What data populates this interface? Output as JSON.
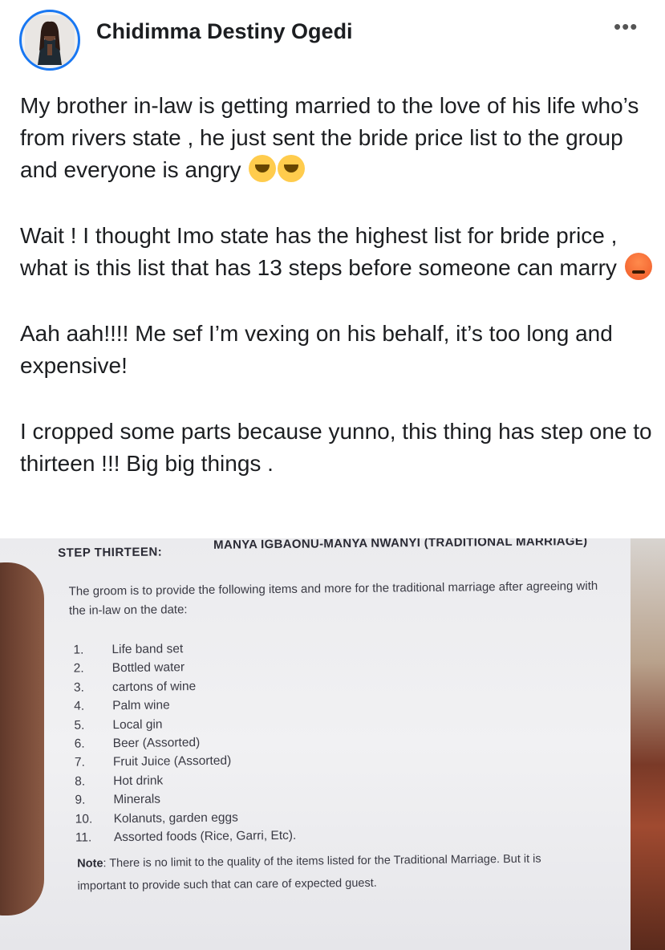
{
  "header": {
    "author": "Chidimma Destiny Ogedi",
    "more_icon": "•••"
  },
  "post": {
    "p1": "My brother in-law is getting married to the love of his life who’s from rivers state , he just sent the bride price list to the group and everyone is angry",
    "p2": "Wait ! I thought Imo state has the highest list for bride price , what is this list that has 13 steps before someone can marry",
    "p3": "Aah aah!!!! Me sef I’m vexing on his behalf, it’s too long and expensive!",
    "p4": "I cropped some parts because yunno, this thing has step one to thirteen !!! Big big things ."
  },
  "emojis": {
    "p1": [
      "face-with-tears-of-joy-icon",
      "face-with-tears-of-joy-icon"
    ],
    "p2": [
      "angry-face-icon"
    ]
  },
  "document": {
    "step_label": "STEP THIRTEEN:",
    "step_title": "MANYA IGBAONU-MANYA NWANYI (TRADITIONAL MARRIAGE)",
    "intro": "The groom is to provide the following items and more for the traditional marriage after agreeing with the in-law on the date:",
    "items": [
      {
        "num": "1.",
        "text": "Life band set"
      },
      {
        "num": "2.",
        "text": "Bottled water"
      },
      {
        "num": "3.",
        "text": "cartons of wine"
      },
      {
        "num": "4.",
        "text": "Palm wine"
      },
      {
        "num": "5.",
        "text": "Local gin"
      },
      {
        "num": "6.",
        "text": "Beer (Assorted)"
      },
      {
        "num": "7.",
        "text": "Fruit Juice (Assorted)"
      },
      {
        "num": "8.",
        "text": "Hot drink"
      },
      {
        "num": "9.",
        "text": "Minerals"
      },
      {
        "num": "10.",
        "text": "Kolanuts, garden eggs"
      },
      {
        "num": "11.",
        "text": "Assorted foods (Rice, Garri, Etc)."
      }
    ],
    "note_label": "Note",
    "note_text": ": There is no limit to the quality of the items listed for the Traditional Marriage. But it is important to provide such that can care of expected guest."
  },
  "colors": {
    "avatar_ring": "#1877f2",
    "text": "#1c1e21"
  }
}
